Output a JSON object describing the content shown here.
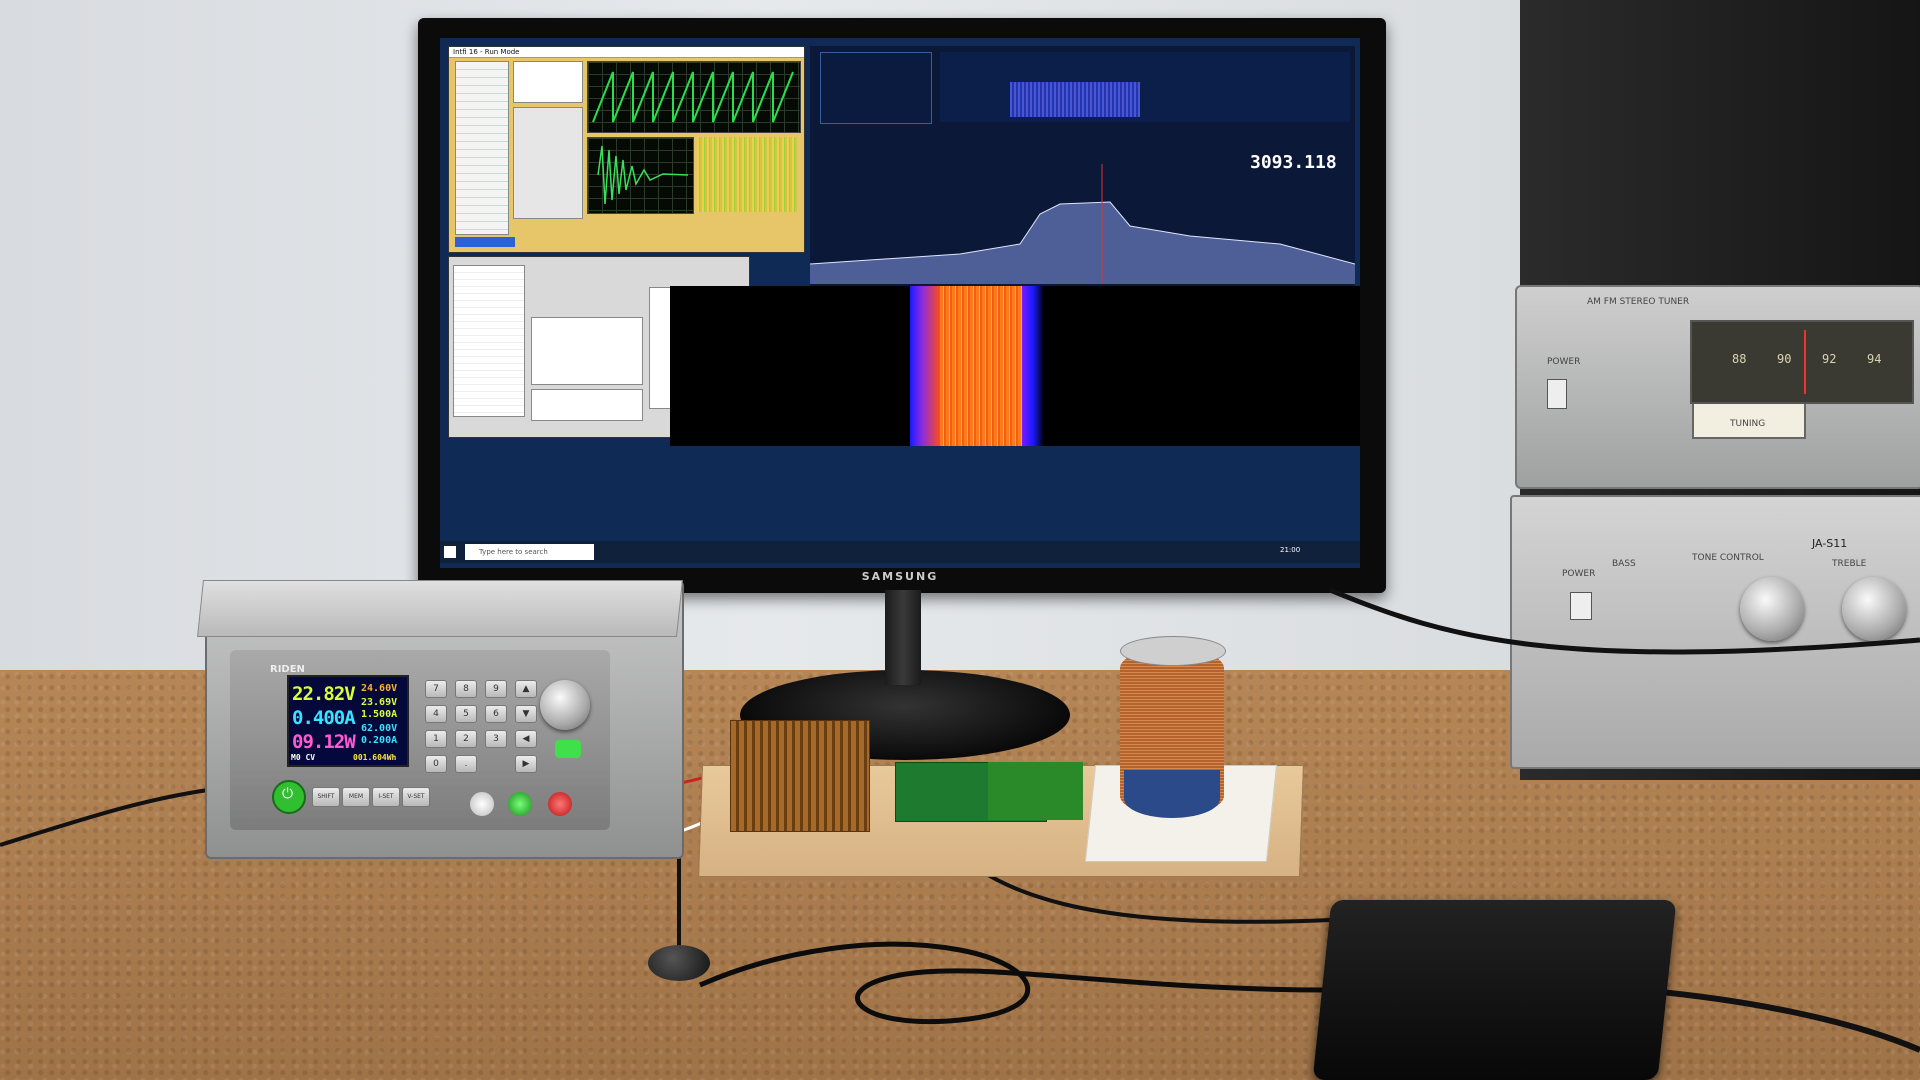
{
  "scene": {
    "monitor": {
      "brand": "SAMSUNG",
      "sdr_frequency_readout": "3093.118",
      "app_title": "Intfi 16 - Run Mode",
      "taskbar_search_placeholder": "Type here to search",
      "taskbar_time": "21:00"
    },
    "power_supply": {
      "brand": "RIDEN",
      "voltage": "22.82V",
      "current": "0.400A",
      "power": "09.12W",
      "input_voltage": "24.60V",
      "set_voltage": "23.69V",
      "set_current": "1.500A",
      "temperature": "62.00V",
      "limit": "0.200A",
      "energy": "001.604Wh",
      "mode": "M0 CV",
      "keypad_keys": [
        "7",
        "8",
        "9",
        "4",
        "5",
        "6",
        "1",
        "2",
        "3",
        "0",
        "."
      ],
      "function_keys": [
        "SHIFT",
        "MEM",
        "I-SET",
        "V-SET"
      ]
    },
    "tuner": {
      "label": "AM FM STEREO TUNER",
      "scale_numbers": [
        "88",
        "90",
        "92",
        "94"
      ],
      "power_label": "POWER",
      "tuning_label": "TUNING"
    },
    "amplifier": {
      "model": "JA-S11",
      "power_label": "POWER",
      "tone_label": "TONE CONTROL",
      "bass_label": "BASS",
      "treble_label": "TREBLE"
    },
    "colors": {
      "lcd_voltage": "#d9ff3a",
      "lcd_current": "#36e4ff",
      "lcd_power": "#ff5ad2",
      "waterfall_signal": "#ff7a1a"
    }
  }
}
